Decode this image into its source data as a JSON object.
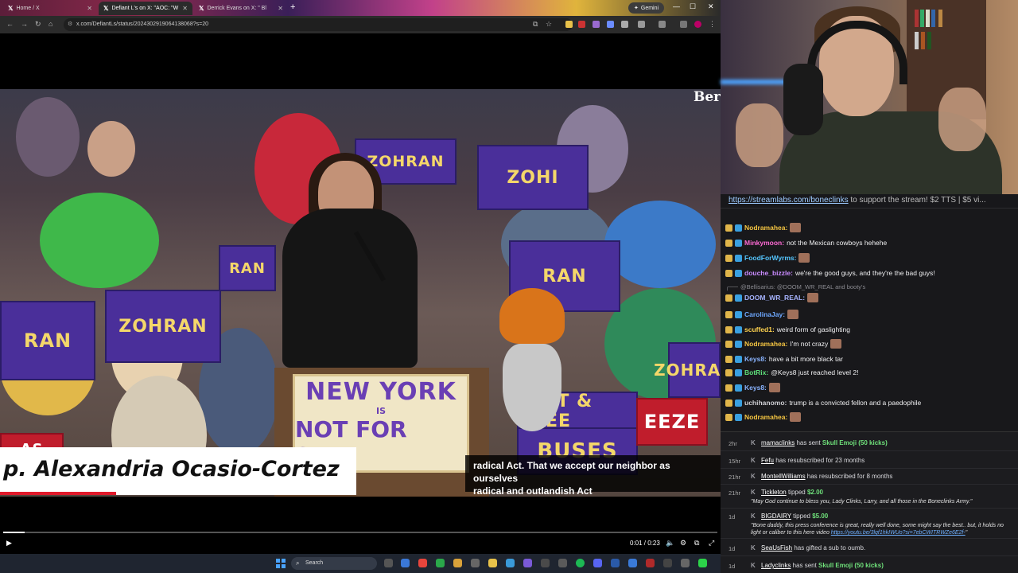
{
  "browser": {
    "tabs": [
      {
        "label": "Home / X"
      },
      {
        "label": "Defiant L's on X: \"AOC: \"W"
      },
      {
        "label": "Derrick Evans on X: \" Bl"
      }
    ],
    "gemini_label": "Gemini",
    "url": "x.com/DefiantLs/status/2024302919064138068?s=20"
  },
  "video": {
    "corner_brand": "Ber",
    "podium_sign": {
      "line1": "NEW YORK",
      "line2": "IS",
      "line3": "NOT FOR SALE"
    },
    "signs": [
      "ZOHRAN",
      "ZOHI",
      "RAN",
      "ZOHRAN",
      "RAN",
      "RAN",
      "FAST & FREE",
      "BUSES",
      "EEZE",
      "ZOHRAN",
      "AS"
    ],
    "lower_third_name": "p. Alexandria Ocasio-Cortez",
    "caption_line1": "radical Act. That we accept our neighbor as ourselves",
    "caption_line2": "radical and outlandish Act",
    "time": "0:01 / 0:23",
    "progress": 0.03
  },
  "taskbar": {
    "search_placeholder": "Search"
  },
  "chat": {
    "pinned_link": "https://streamlabs.com/boneclinks",
    "pinned_text": " to support the stream! $2 TTS | $5 vi...",
    "messages": [
      {
        "user": "Nodramahea:",
        "text": "",
        "color": "#f5c542"
      },
      {
        "user": "Minkymoon:",
        "text": "not the Mexican cowboys hehehe",
        "color": "#ff6ad5"
      },
      {
        "user": "FoodForWyrms:",
        "text": "",
        "color": "#55c6ff"
      },
      {
        "user": "douche_bizzle:",
        "text": "we're the good guys, and they're the bad guys!",
        "color": "#c98bff"
      },
      {
        "reply": "@Bellisarius: @DOOM_WR_REAL and booty's"
      },
      {
        "user": "DOOM_WR_REAL:",
        "text": "",
        "color": "#a7b4ff"
      },
      {
        "user": "CarolinaJay:",
        "text": "",
        "color": "#6ea8ff"
      },
      {
        "user": "scuffed1:",
        "text": "weird form of gaslighting",
        "color": "#ffd34f"
      },
      {
        "user": "Nodramahea:",
        "text": "I'm not crazy",
        "color": "#f5c542"
      },
      {
        "user": "Keys8:",
        "text": "have a bit more black tar",
        "color": "#8ab4ff"
      },
      {
        "user": "BotRix:",
        "text": "@Keys8 just reached level 2!",
        "color": "#5ee07a"
      },
      {
        "user": "Keys8:",
        "text": "",
        "color": "#8ab4ff"
      },
      {
        "user": "uchihanomo:",
        "text": "trump is a convicted fellon and a paedophile",
        "color": "#cfcfd4"
      },
      {
        "user": "Nodramahea:",
        "text": "",
        "color": "#f5c542"
      }
    ]
  },
  "events": [
    {
      "age": "2hr",
      "name": "mamaclinks",
      "text": " has sent ",
      "highlight": "Skull Emoji (50 kicks)"
    },
    {
      "age": "15hr",
      "name": "Fefu",
      "text": " has resubscribed for 23 months"
    },
    {
      "age": "21hr",
      "name": "MontellWilliams",
      "text": " has resubscribed for 8 months"
    },
    {
      "age": "21hr",
      "name": "Tickleton",
      "text": " tipped ",
      "highlight": "$2.00",
      "message": "\"May God continue to bless you, Lady Clinks, Larry, and all those in the Boneclinks Army.\""
    },
    {
      "age": "1d",
      "name": "BIGDAIRY",
      "text": " tipped ",
      "highlight": "$5.00",
      "message": "\"Bone daddy, this press conference is great, really well done, some might say the best.. but, it holds no light or caliber to this here video ",
      "url": "https://youtu.be/3lqf1hkIWUo?si=7ebCWITRWZe6E2f-",
      "message_end": "\""
    },
    {
      "age": "1d",
      "name": "SeaUsFish",
      "text": " has gifted a sub to oumb."
    },
    {
      "age": "1d",
      "name": "Ladyclinks",
      "text": " has sent ",
      "highlight": "Skull Emoji (50 kicks)"
    }
  ],
  "colors": {
    "accent_green": "#6fe07a",
    "chat_bg": "#18181b",
    "sign_purple": "#4a2f9a"
  }
}
